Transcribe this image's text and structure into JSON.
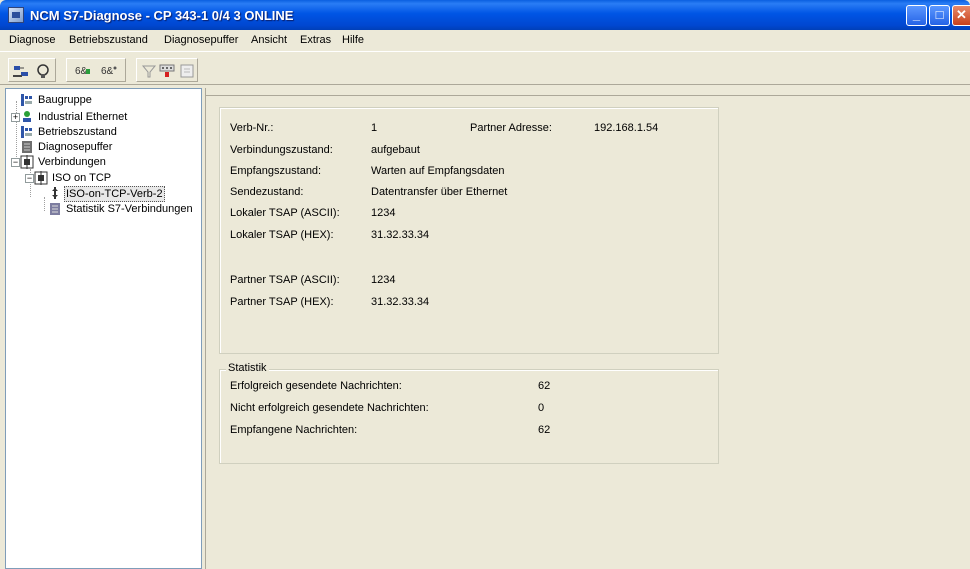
{
  "window": {
    "title": "NCM S7-Diagnose - CP 343-1 0/4 3  ONLINE",
    "min_label": "_",
    "max_label": "□",
    "close_label": "✕"
  },
  "menu": [
    "Diagnose",
    "Betriebszustand",
    "Diagnosepuffer",
    "Ansicht",
    "Extras",
    "Hilfe"
  ],
  "toolbar": {
    "icons": [
      "plug-icon",
      "disconnect-icon",
      "go-online-icon",
      "go-offline-icon",
      "filter-icon",
      "update-icon",
      "print-icon"
    ]
  },
  "tree": {
    "items": [
      {
        "label": "Baugruppe",
        "icon": "module-icon"
      },
      {
        "label": "Industrial Ethernet",
        "icon": "network-icon",
        "expander": "+"
      },
      {
        "label": "Betriebszustand",
        "icon": "module-icon"
      },
      {
        "label": "Diagnosepuffer",
        "icon": "buffer-icon"
      },
      {
        "label": "Verbindungen",
        "icon": "connections-icon",
        "expander": "−"
      },
      {
        "label": "ISO on TCP",
        "icon": "connections-icon",
        "expander": "−"
      },
      {
        "label": "ISO-on-TCP-Verb-2",
        "icon": "link-icon",
        "selected": true
      },
      {
        "label": "Statistik S7-Verbindungen",
        "icon": "statistics-icon"
      }
    ]
  },
  "details": {
    "verb_nr_label": "Verb-Nr.:",
    "verb_nr_value": "1",
    "partner_addr_label": "Partner Adresse:",
    "partner_addr_value": "192.168.1.54",
    "rows": [
      {
        "label": "Verbindungszustand:",
        "value": "aufgebaut"
      },
      {
        "label": "Empfangszustand:",
        "value": "Warten auf Empfangsdaten"
      },
      {
        "label": "Sendezustand:",
        "value": "Datentransfer über Ethernet"
      },
      {
        "label": "Lokaler TSAP (ASCII):",
        "value": "1234"
      },
      {
        "label": "Lokaler TSAP (HEX):",
        "value": "31.32.33.34"
      },
      {
        "label": "Partner TSAP (ASCII):",
        "value": "1234"
      },
      {
        "label": "Partner TSAP (HEX):",
        "value": "31.32.33.34"
      }
    ]
  },
  "statistik": {
    "title": "Statistik",
    "rows": [
      {
        "label": "Erfolgreich gesendete Nachrichten:",
        "value": "62"
      },
      {
        "label": "Nicht erfolgreich gesendete Nachrichten:",
        "value": "0"
      },
      {
        "label": "Empfangene Nachrichten:",
        "value": "62"
      }
    ]
  }
}
